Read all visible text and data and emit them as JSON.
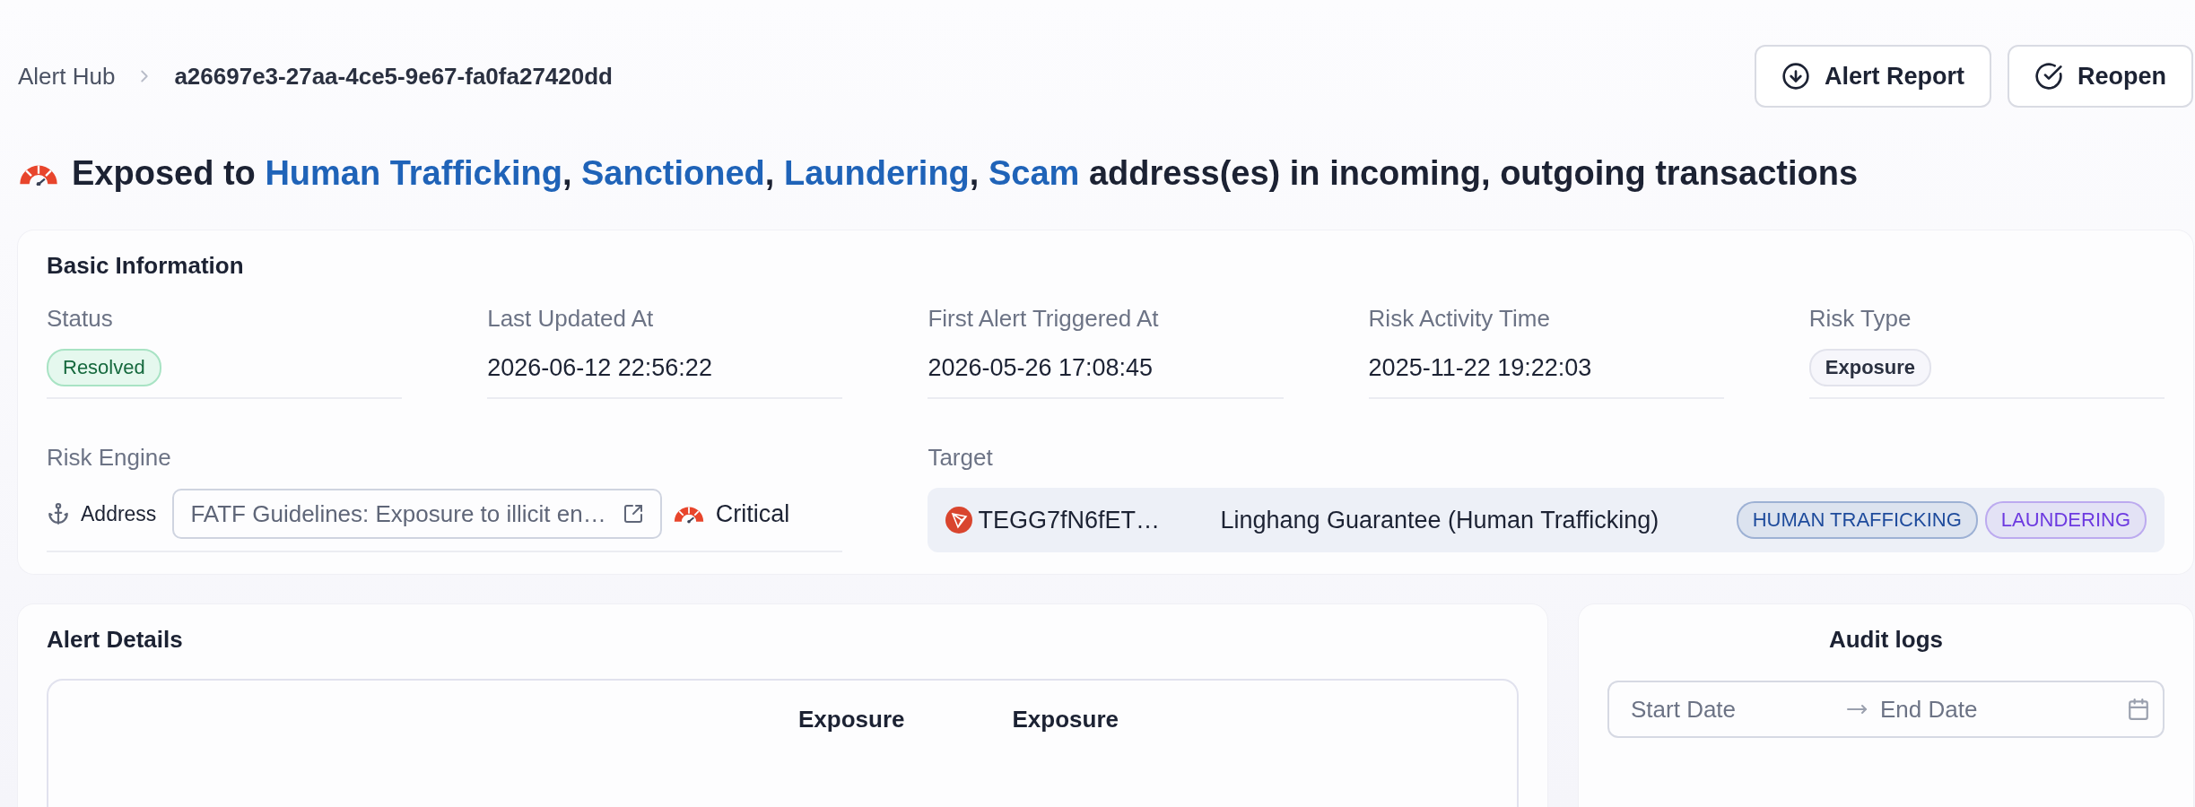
{
  "breadcrumb": [
    {
      "label": "Alert Hub"
    },
    {
      "label": "a26697e3-27aa-4ce5-9e67-fa0fa27420dd"
    }
  ],
  "actions": [
    {
      "label": "Alert Report",
      "kind": "download"
    },
    {
      "label": "Reopen",
      "kind": "check"
    }
  ],
  "headline": [
    {
      "text": "Exposed to ",
      "kind": "plain"
    },
    {
      "text": "Human Trafficking",
      "kind": "link"
    },
    {
      "text": ", ",
      "kind": "plain"
    },
    {
      "text": "Sanctioned",
      "kind": "link"
    },
    {
      "text": ", ",
      "kind": "plain"
    },
    {
      "text": "Laundering",
      "kind": "link"
    },
    {
      "text": ", ",
      "kind": "plain"
    },
    {
      "text": "Scam",
      "kind": "link"
    },
    {
      "text": " address(es) in incoming, outgoing transactions",
      "kind": "plain"
    }
  ],
  "basic_info": {
    "title": "Basic Information",
    "fields": [
      {
        "label": "Status",
        "value": "Resolved",
        "kind": "status"
      },
      {
        "label": "Last Updated At",
        "value": "2026-06-12 22:56:22",
        "kind": "text"
      },
      {
        "label": "First Alert Triggered At",
        "value": "2026-05-26 17:08:45",
        "kind": "text"
      },
      {
        "label": "Risk Activity Time",
        "value": "2025-11-22 19:22:03",
        "kind": "text"
      },
      {
        "label": "Risk Type",
        "value": "Exposure",
        "kind": "tag"
      }
    ],
    "risk_engine": {
      "label": "Risk Engine",
      "type": "Address",
      "rule": "FATF Guidelines: Exposure to illicit en…",
      "severity": "Critical"
    },
    "target": {
      "label": "Target",
      "address": "TEGG7fN6fET…",
      "entity": "Linghang Guarantee (Human Trafficking)",
      "tags": [
        {
          "label": "HUMAN TRAFFICKING",
          "color": "#1e4b9c"
        },
        {
          "label": "LAUNDERING",
          "color": "#6d3ae0"
        }
      ]
    }
  },
  "alert_details": {
    "title": "Alert Details",
    "columns": [
      "Exposure",
      "Exposure"
    ]
  },
  "audit_logs": {
    "title": "Audit logs",
    "start_placeholder": "Start Date",
    "end_placeholder": "End Date"
  }
}
